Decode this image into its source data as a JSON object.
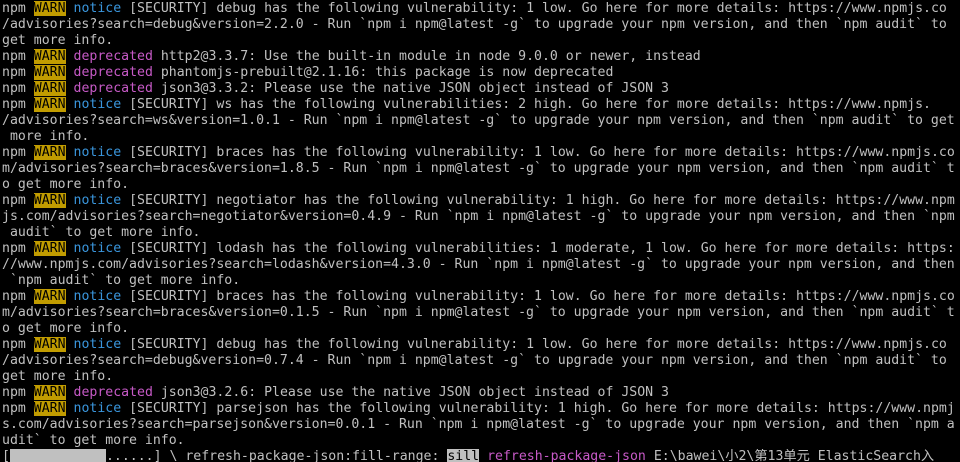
{
  "colors": {
    "background": "#000000",
    "text": "#c0c0c0",
    "warn_bg": "#c19c00",
    "notice": "#3a96dd",
    "deprecated": "#c75ac7"
  },
  "tokens": {
    "npm": "npm",
    "warn": "WARN",
    "notice": "notice",
    "deprecated": "deprecated"
  },
  "lines": [
    {
      "type": "notice",
      "text": "[SECURITY] debug has the following vulnerability: 1 low. Go here for more details: https://www.npmjs.co"
    },
    {
      "type": "plain",
      "text": "/advisories?search=debug&version=2.2.0 - Run `npm i npm@latest -g` to upgrade your npm version, and then `npm audit` to"
    },
    {
      "type": "plain",
      "text": "get more info."
    },
    {
      "type": "deprecated",
      "text": "http2@3.3.7: Use the built-in module in node 9.0.0 or newer, instead"
    },
    {
      "type": "deprecated",
      "text": "phantomjs-prebuilt@2.1.16: this package is now deprecated"
    },
    {
      "type": "deprecated",
      "text": "json3@3.3.2: Please use the native JSON object instead of JSON 3"
    },
    {
      "type": "notice",
      "text": "[SECURITY] ws has the following vulnerabilities: 2 high. Go here for more details: https://www.npmjs."
    },
    {
      "type": "plain",
      "text": "/advisories?search=ws&version=1.0.1 - Run `npm i npm@latest -g` to upgrade your npm version, and then `npm audit` to get"
    },
    {
      "type": "plain",
      "text": " more info."
    },
    {
      "type": "notice",
      "text": "[SECURITY] braces has the following vulnerability: 1 low. Go here for more details: https://www.npmjs.co"
    },
    {
      "type": "plain",
      "text": "m/advisories?search=braces&version=1.8.5 - Run `npm i npm@latest -g` to upgrade your npm version, and then `npm audit` t"
    },
    {
      "type": "plain",
      "text": "o get more info."
    },
    {
      "type": "notice",
      "text": "[SECURITY] negotiator has the following vulnerability: 1 high. Go here for more details: https://www.npm"
    },
    {
      "type": "plain",
      "text": "js.com/advisories?search=negotiator&version=0.4.9 - Run `npm i npm@latest -g` to upgrade your npm version, and then `npm"
    },
    {
      "type": "plain",
      "text": " audit` to get more info."
    },
    {
      "type": "notice",
      "text": "[SECURITY] lodash has the following vulnerabilities: 1 moderate, 1 low. Go here for more details: https:"
    },
    {
      "type": "plain",
      "text": "//www.npmjs.com/advisories?search=lodash&version=4.3.0 - Run `npm i npm@latest -g` to upgrade your npm version, and then"
    },
    {
      "type": "plain",
      "text": " `npm audit` to get more info."
    },
    {
      "type": "notice",
      "text": "[SECURITY] braces has the following vulnerability: 1 low. Go here for more details: https://www.npmjs.co"
    },
    {
      "type": "plain",
      "text": "m/advisories?search=braces&version=0.1.5 - Run `npm i npm@latest -g` to upgrade your npm version, and then `npm audit` t"
    },
    {
      "type": "plain",
      "text": "o get more info."
    },
    {
      "type": "notice",
      "text": "[SECURITY] debug has the following vulnerability: 1 low. Go here for more details: https://www.npmjs.co"
    },
    {
      "type": "plain",
      "text": "/advisories?search=debug&version=0.7.4 - Run `npm i npm@latest -g` to upgrade your npm version, and then `npm audit` to"
    },
    {
      "type": "plain",
      "text": "get more info."
    },
    {
      "type": "deprecated",
      "text": "json3@3.2.6: Please use the native JSON object instead of JSON 3"
    },
    {
      "type": "notice",
      "text": "[SECURITY] parsejson has the following vulnerability: 1 high. Go here for more details: https://www.npmj"
    },
    {
      "type": "plain",
      "text": "s.com/advisories?search=parsejson&version=0.0.1 - Run `npm i npm@latest -g` to upgrade your npm version, and then `npm a"
    },
    {
      "type": "plain",
      "text": "udit` to get more info."
    }
  ],
  "status": {
    "open": "[",
    "dots": "......] \\ refresh-package-json:fill-range: ",
    "silly": "sill",
    "step": "refresh-package-json",
    "path": " E:\\bawei\\小2\\第13单元 ElasticSearch入"
  }
}
